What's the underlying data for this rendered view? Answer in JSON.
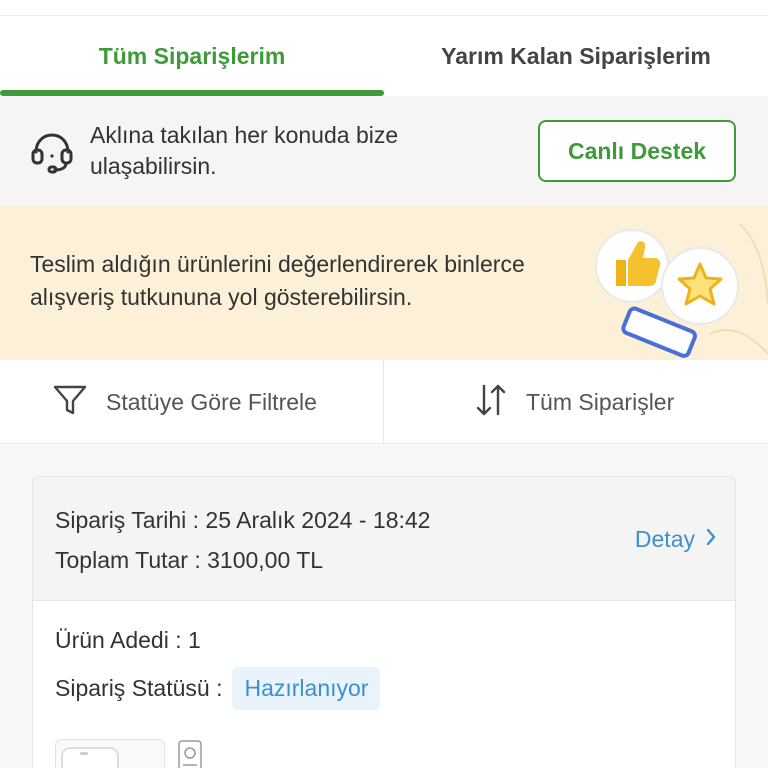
{
  "colors": {
    "brand_green": "#3f9b3a",
    "link_blue": "#3f8fcf",
    "status_blue": "#3f8fcf",
    "promo_bg": "#fdf0d8",
    "support_bg": "#f5f5f5"
  },
  "tabs": [
    {
      "label": "Tüm Siparişlerim",
      "active": true
    },
    {
      "label": "Yarım Kalan Siparişlerim",
      "active": false
    }
  ],
  "support": {
    "icon": "headset-icon",
    "text": "Aklına takılan her konuda bize ulaşabilirsin.",
    "button_label": "Canlı Destek"
  },
  "promo": {
    "text": "Teslim aldığın ürünlerini değerlendirerek binlerce alışveriş tutkununa yol gösterebilirsin.",
    "art_icons": [
      "thumbs-up-icon",
      "star-icon",
      "phone-icon"
    ]
  },
  "filters": {
    "status_filter_label": "Statüye Göre Filtrele",
    "status_filter_icon": "funnel-icon",
    "sort_label": "Tüm Siparişler",
    "sort_icon": "sort-arrows-icon"
  },
  "order": {
    "date_line": "Sipariş Tarihi : 25 Aralık 2024 - 18:42",
    "total_line": "Toplam Tutar : 3100,00 TL",
    "detail_label": "Detay",
    "detail_icon": "chevron-right-icon",
    "item_count_line": "Ürün Adedi : 1",
    "status_prefix": "Sipariş Statüsü :",
    "status_value": "Hazırlanıyor"
  }
}
